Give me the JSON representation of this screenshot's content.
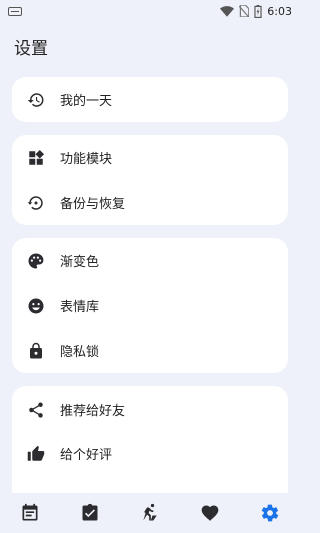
{
  "status_bar": {
    "time": "6:03"
  },
  "page_title": "设置",
  "groups": [
    {
      "items": [
        {
          "label": "我的一天",
          "icon": "history-icon"
        }
      ]
    },
    {
      "items": [
        {
          "label": "功能模块",
          "icon": "widgets-icon"
        },
        {
          "label": "备份与恢复",
          "icon": "restore-icon"
        }
      ]
    },
    {
      "items": [
        {
          "label": "渐变色",
          "icon": "palette-icon"
        },
        {
          "label": "表情库",
          "icon": "emoji-icon"
        },
        {
          "label": "隐私锁",
          "icon": "lock-icon"
        }
      ]
    },
    {
      "items": [
        {
          "label": "推荐给好友",
          "icon": "share-icon"
        },
        {
          "label": "给个好评",
          "icon": "thumb-up-icon"
        }
      ]
    }
  ],
  "bottom_nav": [
    {
      "name": "calendar-icon"
    },
    {
      "name": "task-check-icon"
    },
    {
      "name": "activity-icon"
    },
    {
      "name": "heart-icon"
    },
    {
      "name": "settings-gear-icon",
      "active": true
    }
  ],
  "colors": {
    "background": "#eef1f9",
    "card": "#ffffff",
    "icon": "#2b2b30",
    "accent": "#1a73e8"
  }
}
